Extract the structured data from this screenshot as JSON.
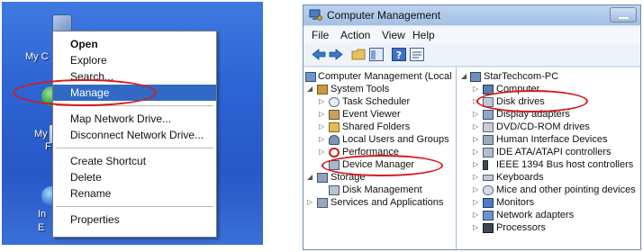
{
  "desktop": {
    "icon_labels": [
      "My C",
      "My",
      "F",
      "In",
      "E"
    ]
  },
  "context_menu": {
    "items": [
      {
        "label": "Open",
        "bold": true
      },
      {
        "label": "Explore"
      },
      {
        "label": "Search..."
      },
      {
        "label": "Manage",
        "selected": true
      },
      {
        "separator": true
      },
      {
        "label": "Map Network Drive..."
      },
      {
        "label": "Disconnect Network Drive..."
      },
      {
        "separator": true
      },
      {
        "label": "Create Shortcut"
      },
      {
        "label": "Delete"
      },
      {
        "label": "Rename"
      },
      {
        "separator": true
      },
      {
        "label": "Properties"
      }
    ]
  },
  "window": {
    "title": "Computer Management",
    "menus": [
      "File",
      "Action",
      "View",
      "Help"
    ],
    "left_tree": [
      {
        "label": "Computer Management (Local",
        "icon": "computer-management-icon"
      },
      {
        "label": "System Tools",
        "icon": "system-tools-icon"
      },
      {
        "label": "Task Scheduler",
        "icon": "task-scheduler-icon"
      },
      {
        "label": "Event Viewer",
        "icon": "event-viewer-icon"
      },
      {
        "label": "Shared Folders",
        "icon": "shared-folders-icon"
      },
      {
        "label": "Local Users and Groups",
        "icon": "users-icon"
      },
      {
        "label": "Performance",
        "icon": "performance-icon"
      },
      {
        "label": "Device Manager",
        "icon": "device-manager-icon"
      },
      {
        "label": "Storage",
        "icon": "storage-icon"
      },
      {
        "label": "Disk Management",
        "icon": "disk-management-icon"
      },
      {
        "label": "Services and Applications",
        "icon": "services-icon"
      }
    ],
    "right_tree": [
      {
        "label": "StarTechcom-PC",
        "icon": "computer-icon"
      },
      {
        "label": "Computer",
        "icon": "computer-icon"
      },
      {
        "label": "Disk drives",
        "icon": "disk-drive-icon"
      },
      {
        "label": "Display adapters",
        "icon": "display-adapter-icon"
      },
      {
        "label": "DVD/CD-ROM drives",
        "icon": "dvd-drive-icon"
      },
      {
        "label": "Human Interface Devices",
        "icon": "hid-icon"
      },
      {
        "label": "IDE ATA/ATAPI controllers",
        "icon": "ide-controller-icon"
      },
      {
        "label": "IEEE 1394 Bus host controllers",
        "icon": "firewire-icon"
      },
      {
        "label": "Keyboards",
        "icon": "keyboard-icon"
      },
      {
        "label": "Mice and other pointing devices",
        "icon": "mouse-icon"
      },
      {
        "label": "Monitors",
        "icon": "monitor-icon"
      },
      {
        "label": "Network adapters",
        "icon": "network-adapter-icon"
      },
      {
        "label": "Processors",
        "icon": "processor-icon"
      }
    ]
  },
  "colors": {
    "desktop_blue": "#2d64d4",
    "menu_selection": "#316ac5",
    "highlight_ellipse": "#d8191e"
  }
}
